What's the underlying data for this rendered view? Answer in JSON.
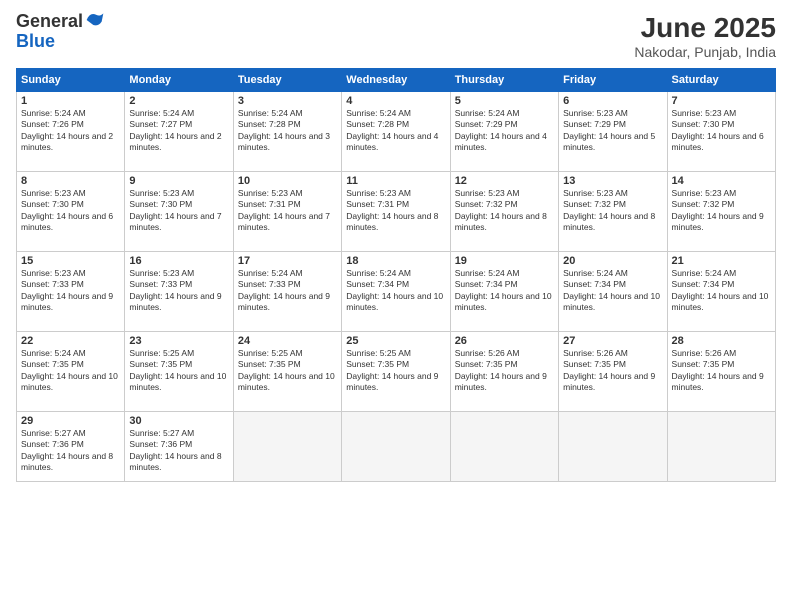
{
  "header": {
    "logo_general": "General",
    "logo_blue": "Blue",
    "month_title": "June 2025",
    "location": "Nakodar, Punjab, India"
  },
  "weekdays": [
    "Sunday",
    "Monday",
    "Tuesday",
    "Wednesday",
    "Thursday",
    "Friday",
    "Saturday"
  ],
  "weeks": [
    [
      {
        "day": "1",
        "sunrise": "Sunrise: 5:24 AM",
        "sunset": "Sunset: 7:26 PM",
        "daylight": "Daylight: 14 hours and 2 minutes."
      },
      {
        "day": "2",
        "sunrise": "Sunrise: 5:24 AM",
        "sunset": "Sunset: 7:27 PM",
        "daylight": "Daylight: 14 hours and 2 minutes."
      },
      {
        "day": "3",
        "sunrise": "Sunrise: 5:24 AM",
        "sunset": "Sunset: 7:28 PM",
        "daylight": "Daylight: 14 hours and 3 minutes."
      },
      {
        "day": "4",
        "sunrise": "Sunrise: 5:24 AM",
        "sunset": "Sunset: 7:28 PM",
        "daylight": "Daylight: 14 hours and 4 minutes."
      },
      {
        "day": "5",
        "sunrise": "Sunrise: 5:24 AM",
        "sunset": "Sunset: 7:29 PM",
        "daylight": "Daylight: 14 hours and 4 minutes."
      },
      {
        "day": "6",
        "sunrise": "Sunrise: 5:23 AM",
        "sunset": "Sunset: 7:29 PM",
        "daylight": "Daylight: 14 hours and 5 minutes."
      },
      {
        "day": "7",
        "sunrise": "Sunrise: 5:23 AM",
        "sunset": "Sunset: 7:30 PM",
        "daylight": "Daylight: 14 hours and 6 minutes."
      }
    ],
    [
      {
        "day": "8",
        "sunrise": "Sunrise: 5:23 AM",
        "sunset": "Sunset: 7:30 PM",
        "daylight": "Daylight: 14 hours and 6 minutes."
      },
      {
        "day": "9",
        "sunrise": "Sunrise: 5:23 AM",
        "sunset": "Sunset: 7:30 PM",
        "daylight": "Daylight: 14 hours and 7 minutes."
      },
      {
        "day": "10",
        "sunrise": "Sunrise: 5:23 AM",
        "sunset": "Sunset: 7:31 PM",
        "daylight": "Daylight: 14 hours and 7 minutes."
      },
      {
        "day": "11",
        "sunrise": "Sunrise: 5:23 AM",
        "sunset": "Sunset: 7:31 PM",
        "daylight": "Daylight: 14 hours and 8 minutes."
      },
      {
        "day": "12",
        "sunrise": "Sunrise: 5:23 AM",
        "sunset": "Sunset: 7:32 PM",
        "daylight": "Daylight: 14 hours and 8 minutes."
      },
      {
        "day": "13",
        "sunrise": "Sunrise: 5:23 AM",
        "sunset": "Sunset: 7:32 PM",
        "daylight": "Daylight: 14 hours and 8 minutes."
      },
      {
        "day": "14",
        "sunrise": "Sunrise: 5:23 AM",
        "sunset": "Sunset: 7:32 PM",
        "daylight": "Daylight: 14 hours and 9 minutes."
      }
    ],
    [
      {
        "day": "15",
        "sunrise": "Sunrise: 5:23 AM",
        "sunset": "Sunset: 7:33 PM",
        "daylight": "Daylight: 14 hours and 9 minutes."
      },
      {
        "day": "16",
        "sunrise": "Sunrise: 5:23 AM",
        "sunset": "Sunset: 7:33 PM",
        "daylight": "Daylight: 14 hours and 9 minutes."
      },
      {
        "day": "17",
        "sunrise": "Sunrise: 5:24 AM",
        "sunset": "Sunset: 7:33 PM",
        "daylight": "Daylight: 14 hours and 9 minutes."
      },
      {
        "day": "18",
        "sunrise": "Sunrise: 5:24 AM",
        "sunset": "Sunset: 7:34 PM",
        "daylight": "Daylight: 14 hours and 10 minutes."
      },
      {
        "day": "19",
        "sunrise": "Sunrise: 5:24 AM",
        "sunset": "Sunset: 7:34 PM",
        "daylight": "Daylight: 14 hours and 10 minutes."
      },
      {
        "day": "20",
        "sunrise": "Sunrise: 5:24 AM",
        "sunset": "Sunset: 7:34 PM",
        "daylight": "Daylight: 14 hours and 10 minutes."
      },
      {
        "day": "21",
        "sunrise": "Sunrise: 5:24 AM",
        "sunset": "Sunset: 7:34 PM",
        "daylight": "Daylight: 14 hours and 10 minutes."
      }
    ],
    [
      {
        "day": "22",
        "sunrise": "Sunrise: 5:24 AM",
        "sunset": "Sunset: 7:35 PM",
        "daylight": "Daylight: 14 hours and 10 minutes."
      },
      {
        "day": "23",
        "sunrise": "Sunrise: 5:25 AM",
        "sunset": "Sunset: 7:35 PM",
        "daylight": "Daylight: 14 hours and 10 minutes."
      },
      {
        "day": "24",
        "sunrise": "Sunrise: 5:25 AM",
        "sunset": "Sunset: 7:35 PM",
        "daylight": "Daylight: 14 hours and 10 minutes."
      },
      {
        "day": "25",
        "sunrise": "Sunrise: 5:25 AM",
        "sunset": "Sunset: 7:35 PM",
        "daylight": "Daylight: 14 hours and 9 minutes."
      },
      {
        "day": "26",
        "sunrise": "Sunrise: 5:26 AM",
        "sunset": "Sunset: 7:35 PM",
        "daylight": "Daylight: 14 hours and 9 minutes."
      },
      {
        "day": "27",
        "sunrise": "Sunrise: 5:26 AM",
        "sunset": "Sunset: 7:35 PM",
        "daylight": "Daylight: 14 hours and 9 minutes."
      },
      {
        "day": "28",
        "sunrise": "Sunrise: 5:26 AM",
        "sunset": "Sunset: 7:35 PM",
        "daylight": "Daylight: 14 hours and 9 minutes."
      }
    ],
    [
      {
        "day": "29",
        "sunrise": "Sunrise: 5:27 AM",
        "sunset": "Sunset: 7:36 PM",
        "daylight": "Daylight: 14 hours and 8 minutes."
      },
      {
        "day": "30",
        "sunrise": "Sunrise: 5:27 AM",
        "sunset": "Sunset: 7:36 PM",
        "daylight": "Daylight: 14 hours and 8 minutes."
      },
      null,
      null,
      null,
      null,
      null
    ]
  ]
}
